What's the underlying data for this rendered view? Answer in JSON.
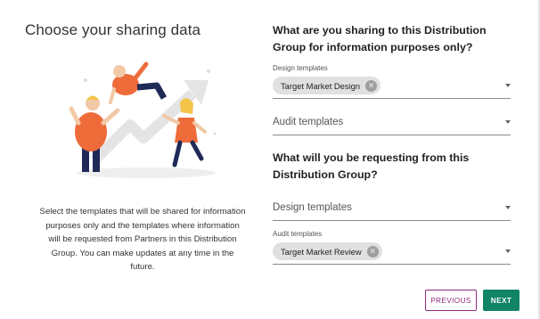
{
  "page": {
    "title": "Choose your sharing data",
    "description": "Select the templates that will be shared for information purposes only and the templates where information will be requested from Partners in this Distribution Group. You can make updates at any time in the future."
  },
  "sharing": {
    "heading": "What are you sharing to this Distribution Group for information purposes only?",
    "design_templates": {
      "label": "Design templates",
      "chips": [
        "Target Market Design"
      ]
    },
    "audit_templates": {
      "placeholder": "Audit templates"
    }
  },
  "requesting": {
    "heading": "What will you be requesting from this Distribution Group?",
    "design_templates": {
      "placeholder": "Design templates"
    },
    "audit_templates": {
      "label": "Audit templates",
      "chips": [
        "Target Market Review"
      ]
    }
  },
  "buttons": {
    "previous": "PREVIOUS",
    "next": "NEXT"
  },
  "icons": {
    "chip_remove": "close-circle-icon",
    "dropdown": "caret-down-icon"
  },
  "colors": {
    "primary_green": "#118466",
    "secondary_purple": "#8e2a7d",
    "illustration_orange": "#ee6b3a",
    "illustration_navy": "#1f2a57"
  }
}
